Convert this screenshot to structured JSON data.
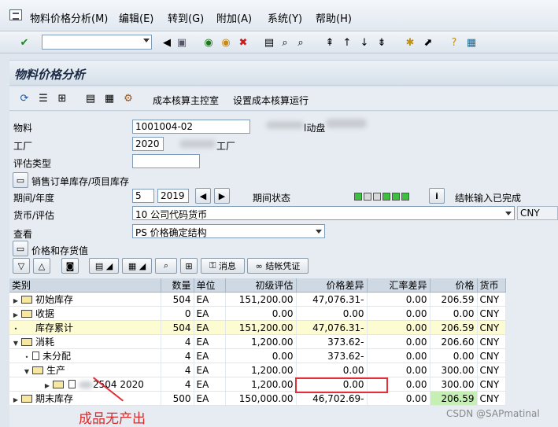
{
  "menu": {
    "items": [
      "物料价格分析(M)",
      "编辑(E)",
      "转到(G)",
      "附加(A)",
      "系统(Y)",
      "帮助(H)"
    ]
  },
  "title": "物料价格分析",
  "app_toolbar": {
    "cost_cockpit": "成本核算主控室",
    "set_costing_run": "设置成本核算运行"
  },
  "form": {
    "material_label": "物料",
    "material_value": "1001004-02",
    "material_desc_suffix": "l动盘",
    "plant_label": "工厂",
    "plant_value": "2020",
    "plant_desc_suffix": "工厂",
    "valuation_type_label": "评估类型",
    "valuation_type_value": "",
    "sales_order_stock_button": "销售订单库存/项目库存",
    "period_label": "期间/年度",
    "period_value": "5",
    "year_value": "2019",
    "period_status_label": "期间状态",
    "period_status_text": "结帐输入已完成",
    "currency_label": "货币/评估",
    "currency_value": "10 公司代码货币",
    "currency_code": "CNY",
    "view_label": "查看",
    "view_value": "PS 价格确定结构",
    "price_stock_button": "价格和存货值"
  },
  "grid_toolbar": {
    "messages": "消息",
    "closing_doc": "结帐凭证"
  },
  "table": {
    "headers": [
      "类别",
      "数量",
      "单位",
      "初级评估",
      "价格差异",
      "汇率差异",
      "价格",
      "货币"
    ],
    "rows": [
      {
        "cat": "初始库存",
        "qty": "504",
        "unit": "EA",
        "prelim": "151,200.00",
        "pdiff": "47,076.31-",
        "xdiff": "0.00",
        "price": "206.59",
        "cur": "CNY"
      },
      {
        "cat": "收据",
        "qty": "0",
        "unit": "EA",
        "prelim": "0.00",
        "pdiff": "0.00",
        "xdiff": "0.00",
        "price": "0.00",
        "cur": "CNY"
      },
      {
        "cat": "库存累计",
        "qty": "504",
        "unit": "EA",
        "prelim": "151,200.00",
        "pdiff": "47,076.31-",
        "xdiff": "0.00",
        "price": "206.59",
        "cur": "CNY"
      },
      {
        "cat": "消耗",
        "qty": "4",
        "unit": "EA",
        "prelim": "1,200.00",
        "pdiff": "373.62-",
        "xdiff": "0.00",
        "price": "206.60",
        "cur": "CNY"
      },
      {
        "cat": "未分配",
        "qty": "4",
        "unit": "EA",
        "prelim": "0.00",
        "pdiff": "373.62-",
        "xdiff": "0.00",
        "price": "0.00",
        "cur": "CNY"
      },
      {
        "cat": "生产",
        "qty": "4",
        "unit": "EA",
        "prelim": "1,200.00",
        "pdiff": "0.00",
        "xdiff": "0.00",
        "price": "300.00",
        "cur": "CNY"
      },
      {
        "cat": "2504 2020",
        "qty": "4",
        "unit": "EA",
        "prelim": "1,200.00",
        "pdiff": "0.00",
        "xdiff": "0.00",
        "price": "300.00",
        "cur": "CNY"
      },
      {
        "cat": "期末库存",
        "qty": "500",
        "unit": "EA",
        "prelim": "150,000.00",
        "pdiff": "46,702.69-",
        "xdiff": "0.00",
        "price": "206.59",
        "cur": "CNY"
      }
    ]
  },
  "annotation": "成品无产出",
  "watermark": "CSDN @SAPmatinal",
  "colors": {
    "highlight_row": "#fdfbd2",
    "price_highlight": "#c6efb6",
    "annotation_red": "#d92b2b",
    "status_green": "#3fbf3f"
  }
}
